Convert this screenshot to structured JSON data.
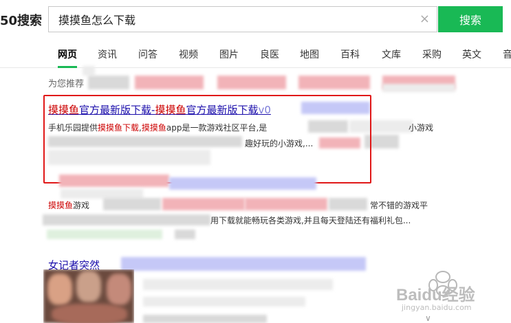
{
  "header": {
    "logo_text": "50搜索",
    "search_value": "摸摸鱼怎么下载",
    "clear_glyph": "×",
    "search_button": "搜索"
  },
  "tabs": [
    {
      "label": "网页",
      "active": true
    },
    {
      "label": "资讯"
    },
    {
      "label": "问答"
    },
    {
      "label": "视频"
    },
    {
      "label": "图片"
    },
    {
      "label": "良医"
    },
    {
      "label": "地图"
    },
    {
      "label": "百科"
    },
    {
      "label": "文库"
    },
    {
      "label": "采购"
    },
    {
      "label": "英文"
    },
    {
      "label": "音"
    }
  ],
  "recommend_label": "为您推荐",
  "result1": {
    "title_hl1": "摸摸鱼",
    "title_mid": "官方最新版下载-",
    "title_hl2": "摸摸鱼",
    "title_end": "官方最新版下载",
    "title_tail": "v0",
    "snippet_pre": "手机乐园提供",
    "snippet_hl1": "摸摸鱼下载",
    "snippet_sep": ",",
    "snippet_hl2": "摸摸鱼",
    "snippet_post": "app是一款游戏社区平台,是",
    "snippet_right": "小游戏",
    "snippet_line2": "趣好玩的小游戏,..."
  },
  "result2": {
    "title_hl": "摸摸鱼",
    "title_rest": "游戏",
    "snippet_right": "常不错的游戏平",
    "snippet_line2": "用下载就能畅玩各类游戏,并且每天登陆还有福利礼包..."
  },
  "result3": {
    "title": "女记者突然"
  },
  "watermark": {
    "brand": "Baidu经验",
    "url": "jingyan.baidu.com"
  },
  "more_glyph": "∨"
}
